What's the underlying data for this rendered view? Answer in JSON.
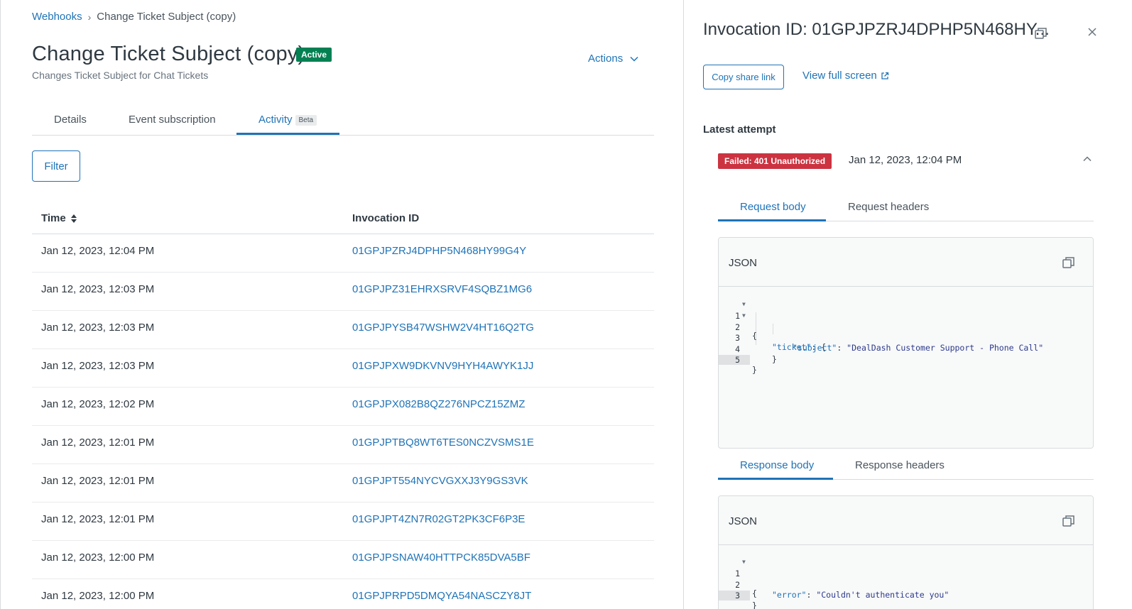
{
  "breadcrumb": {
    "root": "Webhooks",
    "separator": "›",
    "current": "Change Ticket Subject (copy)"
  },
  "header": {
    "title": "Change Ticket Subject (copy)",
    "status": "Active",
    "subtitle": "Changes Ticket Subject for Chat Tickets",
    "actions_label": "Actions"
  },
  "tabs": [
    {
      "label": "Details"
    },
    {
      "label": "Event subscription"
    },
    {
      "label": "Activity",
      "badge": "Beta",
      "active": true
    }
  ],
  "filter_label": "Filter",
  "table": {
    "columns": [
      "Time",
      "Invocation ID"
    ],
    "rows": [
      {
        "time": "Jan 12, 2023, 12:04 PM",
        "id": "01GPJPZRJ4DPHP5N468HY99G4Y"
      },
      {
        "time": "Jan 12, 2023, 12:03 PM",
        "id": "01GPJPZ31EHRXSRVF4SQBZ1MG6"
      },
      {
        "time": "Jan 12, 2023, 12:03 PM",
        "id": "01GPJPYSB47WSHW2V4HT16Q2TG"
      },
      {
        "time": "Jan 12, 2023, 12:03 PM",
        "id": "01GPJPXW9DKVNV9HYH4AWYK1JJ"
      },
      {
        "time": "Jan 12, 2023, 12:02 PM",
        "id": "01GPJPX082B8QZ276NPCZ15ZMZ"
      },
      {
        "time": "Jan 12, 2023, 12:01 PM",
        "id": "01GPJPTBQ8WT6TES0NCZVSMS1E"
      },
      {
        "time": "Jan 12, 2023, 12:01 PM",
        "id": "01GPJPT554NYCVGXXJ3Y9GS3VK"
      },
      {
        "time": "Jan 12, 2023, 12:01 PM",
        "id": "01GPJPT4ZN7R02GT2PK3CF6P3E"
      },
      {
        "time": "Jan 12, 2023, 12:00 PM",
        "id": "01GPJPSNAW40HTTPCK85DVA5BF"
      },
      {
        "time": "Jan 12, 2023, 12:00 PM",
        "id": "01GPJPRPD5DMQYA54NASCZY8JT"
      }
    ]
  },
  "panel": {
    "title": "Invocation ID: 01GPJPZRJ4DPHP5N468HY...",
    "copy_share_link": "Copy share link",
    "view_full_screen": "View full screen",
    "latest_attempt_label": "Latest attempt",
    "attempt_status": "Failed: 401 Unauthorized",
    "attempt_time": "Jan 12, 2023, 12:04 PM",
    "request_tabs": [
      "Request body",
      "Request headers"
    ],
    "response_tabs": [
      "Response body",
      "Response headers"
    ],
    "request_lang": "JSON",
    "response_lang": "JSON",
    "request_lines": [
      "1",
      "2",
      "3",
      "4",
      "5"
    ],
    "request_code": {
      "l1": "{",
      "l2_key": "\"ticket\"",
      "l2_rest": ": {",
      "l3_key": "\"subject\"",
      "l3_sep": ": ",
      "l3_val": "\"DealDash Customer Support - Phone Call\"",
      "l4": "}",
      "l5": "}"
    },
    "response_lines": [
      "1",
      "2",
      "3"
    ],
    "response_code": {
      "l1": "{",
      "l2_key": "\"error\"",
      "l2_sep": ": ",
      "l2_val": "\"Couldn't authenticate you\"",
      "l3": "}"
    }
  },
  "colors": {
    "link": "#1f73b7",
    "active_badge": "#038153",
    "failed_badge": "#cc3340",
    "border": "#d8dcde"
  },
  "icons": [
    "sort-icon",
    "chevron-down-icon",
    "copy-icon",
    "close-icon",
    "external-link-icon",
    "chevron-up-icon",
    "fold-arrow-icon"
  ]
}
